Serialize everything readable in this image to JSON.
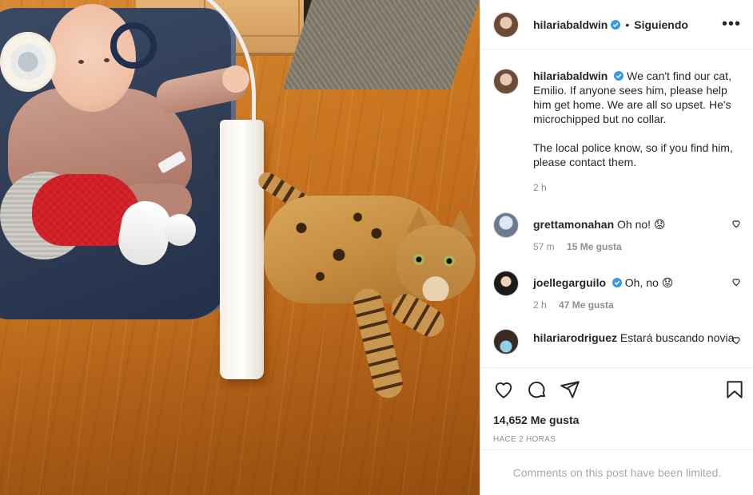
{
  "post": {
    "author": "hilariabaldwin",
    "follow_status": "Siguiendo",
    "separator": "•",
    "more_label": "•••"
  },
  "caption": {
    "username": "hilariabaldwin",
    "text_1": "We can't find our cat, Emilio. If anyone sees him, please help him get home. We are all so upset. He's microchipped but no collar.",
    "text_2": "The local police know, so if you find him, please contact them.",
    "time": "2 h"
  },
  "comments": [
    {
      "username": "grettamonahan",
      "text": "Oh no! 😟",
      "time": "57 m",
      "likes": "15 Me gusta",
      "verified": false
    },
    {
      "username": "joellegarguilo",
      "text": "Oh, no 😟",
      "time": "2 h",
      "likes": "47 Me gusta",
      "verified": true
    },
    {
      "username": "hilariarodriguez",
      "text": "Estará buscando novia",
      "time": "",
      "likes": "",
      "verified": false
    }
  ],
  "stats": {
    "likes": "14,652 Me gusta",
    "posted": "HACE 2 HORAS"
  },
  "limited_notice": "Comments on this post have been limited.",
  "colors": {
    "text": "#262626",
    "muted": "#8e8e8e",
    "verified": "#3897f0",
    "border": "#efefef"
  },
  "icons": [
    "heart-icon",
    "comment-icon",
    "share-icon",
    "bookmark-icon",
    "verified-badge-icon",
    "more-options-icon"
  ]
}
